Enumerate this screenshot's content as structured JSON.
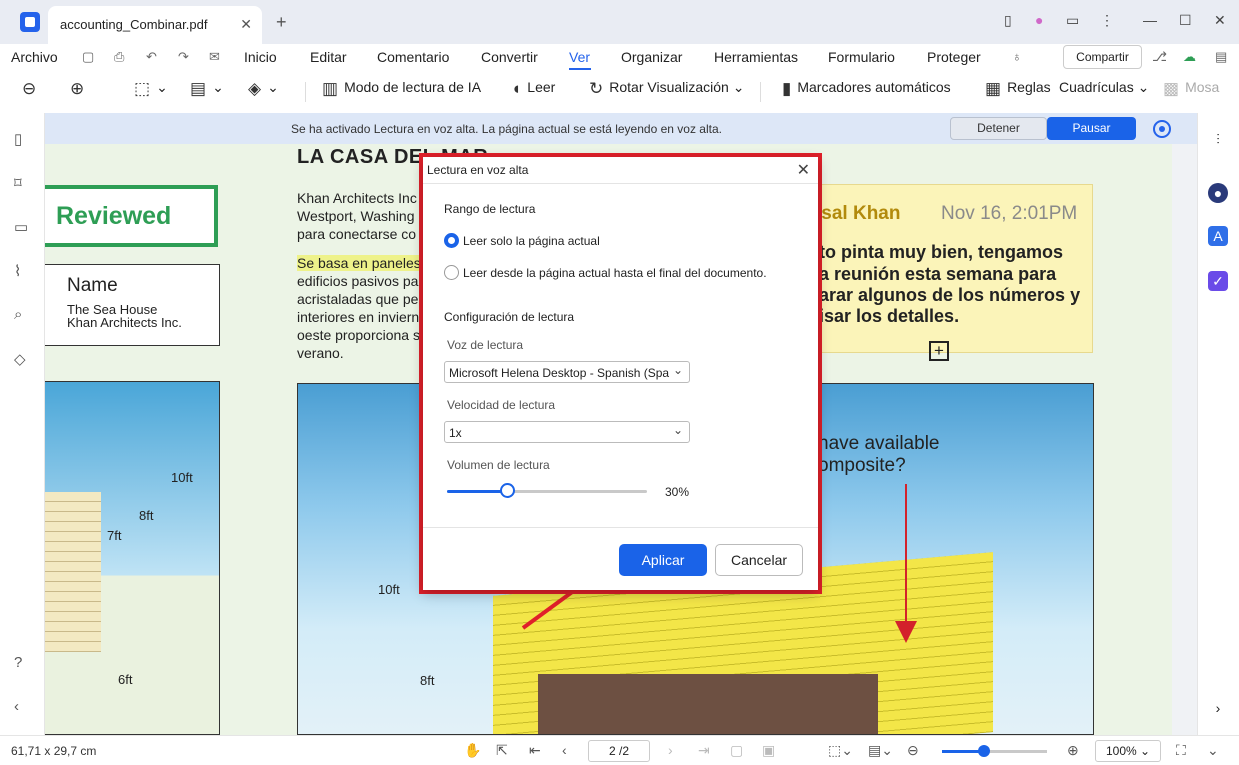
{
  "window": {
    "tab_title": "accounting_Combinar.pdf",
    "close_tab": "✕",
    "new_tab": "+",
    "minimize": "—",
    "maximize": "☐",
    "close": "✕"
  },
  "menu": {
    "file": "Archivo",
    "items": [
      "Inicio",
      "Editar",
      "Comentario",
      "Convertir",
      "Ver",
      "Organizar",
      "Herramientas",
      "Formulario",
      "Proteger"
    ],
    "active": "Ver",
    "share": "Compartir"
  },
  "toolbar": {
    "ai_reading_mode": "Modo de lectura de IA",
    "read": "Leer",
    "rotate_view": "Rotar Visualización",
    "auto_bookmarks": "Marcadores automáticos",
    "rulers": "Reglas",
    "grids": "Cuadrículas",
    "mosaic": "Mosa"
  },
  "notification": {
    "text": "Se ha activado Lectura en voz alta. La página actual se está leyendo en voz alta.",
    "stop": "Detener",
    "pause": "Pausar"
  },
  "document": {
    "stamp": "Reviewed",
    "name_box": {
      "title": "Name",
      "line1": "The Sea House",
      "line2": "Khan Architects Inc."
    },
    "heading": "LA CASA DEL MAR",
    "para1": [
      "Khan Architects Inc",
      "Westport, Washing",
      "para conectarse co"
    ],
    "para2_highlight": "Se basa en paneles",
    "para2": [
      "edificios pasivos pa",
      "acristaladas que pe",
      "interiores en inviern",
      "oeste proporciona s",
      "verano."
    ],
    "sticky": {
      "author": "isal Khan",
      "date": "Nov 16, 2:01PM",
      "lines": [
        "to pinta muy bien, tengamos",
        "a reunión esta semana para",
        "arar algunos de los números y",
        "isar los detalles."
      ]
    },
    "sky_text": [
      "have available",
      "omposite?"
    ],
    "dims": {
      "d10ft_a": "10ft",
      "d8ft_a": "8ft",
      "d7ft": "7ft",
      "d6ft": "6ft",
      "d10ft_b": "10ft",
      "d8ft_b": "8ft"
    }
  },
  "dialog": {
    "title": "Lectura en voz alta",
    "range_section": "Rango de lectura",
    "option1": "Leer solo la página actual",
    "option2": "Leer desde la página actual hasta el final del documento.",
    "config_section": "Configuración de lectura",
    "voice_label": "Voz de lectura",
    "voice_value": "Microsoft Helena Desktop - Spanish (Spain)",
    "speed_label": "Velocidad de lectura",
    "speed_value": "1x",
    "volume_label": "Volumen de lectura",
    "volume_percent": 30,
    "volume_text": "30%",
    "apply": "Aplicar",
    "cancel": "Cancelar"
  },
  "statusbar": {
    "dimensions": "61,71 x 29,7 cm",
    "page": "2 /2",
    "zoom": "100%",
    "zoom_fraction": 0.4
  },
  "colors": {
    "accent": "#1a63e8",
    "highlight_frame": "#e0202a",
    "stamp_green": "#2e9e55",
    "sticky_yellow": "#fbf4b9"
  }
}
